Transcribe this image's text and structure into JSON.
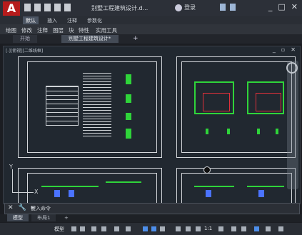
{
  "app": {
    "logo_letter": "A",
    "title": "别墅工程建筑设计.d...",
    "signin_label": "登录",
    "window_controls": [
      "_",
      "□",
      "✕"
    ]
  },
  "ribbon_tabs": {
    "items": [
      "默认",
      "插入",
      "注释",
      "参数化"
    ],
    "active": "默认"
  },
  "menubar": {
    "items": [
      "绘图",
      "修改",
      "注释",
      "图层",
      "块",
      "特性",
      "实用工具"
    ]
  },
  "file_tabs": {
    "items": [
      "开始",
      "别墅工程建筑设计*"
    ],
    "active": "别墅工程建筑设计*",
    "add_symbol": "+"
  },
  "viewport": {
    "label": "[-][俯视][二维线框]",
    "controls": [
      "_",
      "▫",
      "✕"
    ],
    "ucs_y": "Y",
    "ucs_x": "X"
  },
  "command": {
    "icons": [
      "✕",
      "🔧",
      "▸"
    ],
    "prompt": "键入命令"
  },
  "layout_tabs": {
    "items": [
      "模型",
      "布局1"
    ],
    "active": "模型",
    "add_symbol": "+"
  },
  "statusbar": {
    "model_label": "模型",
    "scale": "1:1"
  },
  "colors": {
    "linework_green": "#2fd43a",
    "room_red": "#e0303a",
    "canvas_bg": "#212830",
    "accent_red": "#b61c1c"
  }
}
